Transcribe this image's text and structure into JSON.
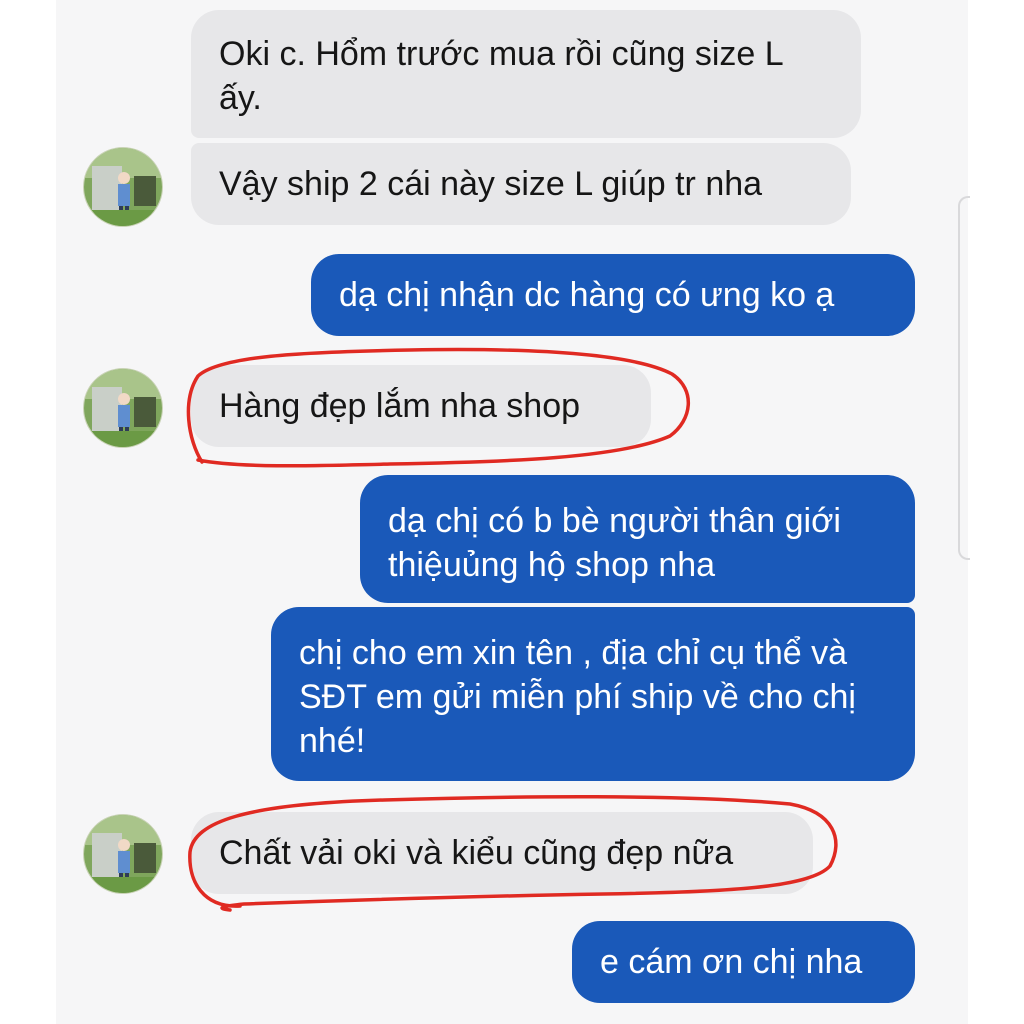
{
  "messages": [
    {
      "side": "in",
      "text": "Oki c. Hổm trước mua rồi cũng size L ấy."
    },
    {
      "side": "in",
      "text": "Vậy ship 2 cái này size L giúp tr nha"
    },
    {
      "side": "out",
      "text": "dạ chị nhận dc hàng có ưng ko ạ"
    },
    {
      "side": "in",
      "text": "Hàng đẹp lắm nha shop"
    },
    {
      "side": "out",
      "text": "dạ chị có b bè người thân giới thiệuủng hộ shop nha"
    },
    {
      "side": "out",
      "text": "chị cho em xin tên , địa chỉ cụ thể và SĐT em gửi miễn phí ship về cho chị nhé!"
    },
    {
      "side": "in",
      "text": "Chất vải oki và kiểu cũng đẹp nữa"
    },
    {
      "side": "out",
      "text": "e cám ơn chị nha"
    }
  ],
  "colors": {
    "incoming_bubble": "#e7e7e9",
    "outgoing_bubble": "#1a59b9",
    "highlight_mark": "#e02a22",
    "background": "#f6f6f7"
  },
  "icons": {
    "avatar": "contact-avatar-photo",
    "highlight": "red-hand-drawn-circle"
  }
}
